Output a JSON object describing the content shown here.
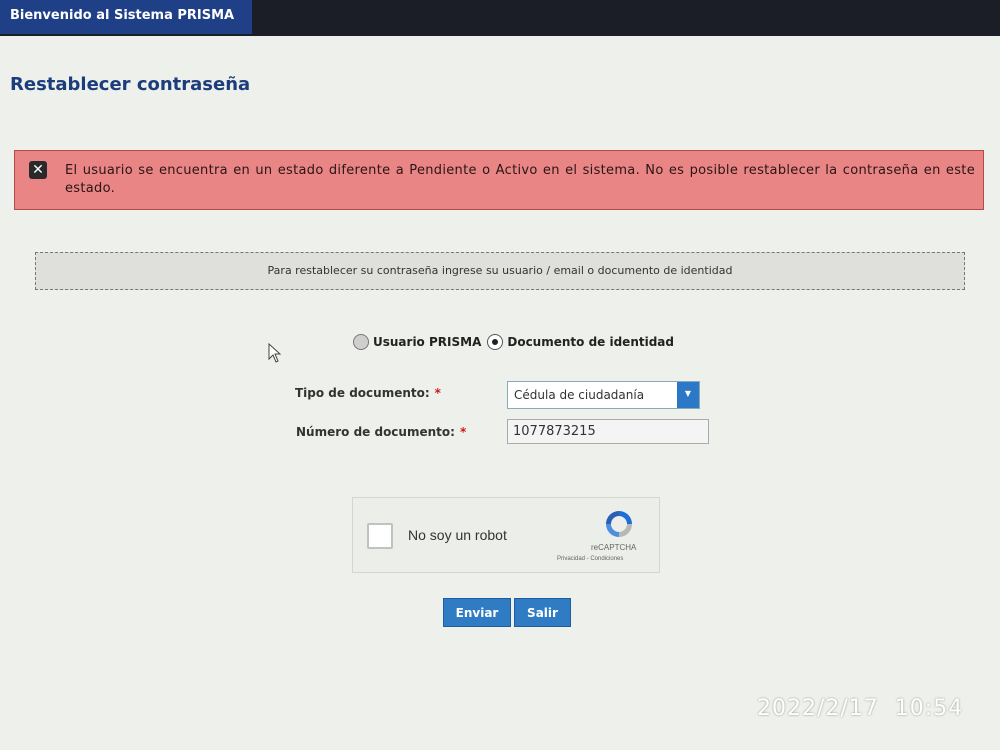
{
  "header": {
    "tab_label": "Bienvenido al Sistema PRISMA"
  },
  "page": {
    "title": "Restablecer contraseña"
  },
  "error": {
    "icon": "close-icon",
    "message": "El usuario se encuentra en un estado diferente a Pendiente o Activo en el sistema. No es posible restablecer la contraseña en este estado."
  },
  "info": {
    "text": "Para restablecer su contraseña ingrese su usuario / email o documento de identidad"
  },
  "mode": {
    "options": [
      {
        "label": "Usuario PRISMA",
        "selected": false
      },
      {
        "label": "Documento de identidad",
        "selected": true
      }
    ]
  },
  "form": {
    "doc_type_label": "Tipo de documento:",
    "doc_type_value": "Cédula de ciudadanía",
    "doc_number_label": "Número de documento:",
    "doc_number_value": "1077873215",
    "required_marker": "*"
  },
  "captcha": {
    "label": "No soy un robot",
    "brand": "reCAPTCHA",
    "links": "Privacidad - Condiciones"
  },
  "actions": {
    "submit_label": "Enviar",
    "exit_label": "Salir"
  },
  "photo_timestamp": "2022/2/17 10:54",
  "colors": {
    "header_bg": "#1b1e27",
    "tab_bg": "#1f3f86",
    "title": "#1c3d7c",
    "error_bg": "#e98585",
    "button": "#2f7cc4"
  }
}
